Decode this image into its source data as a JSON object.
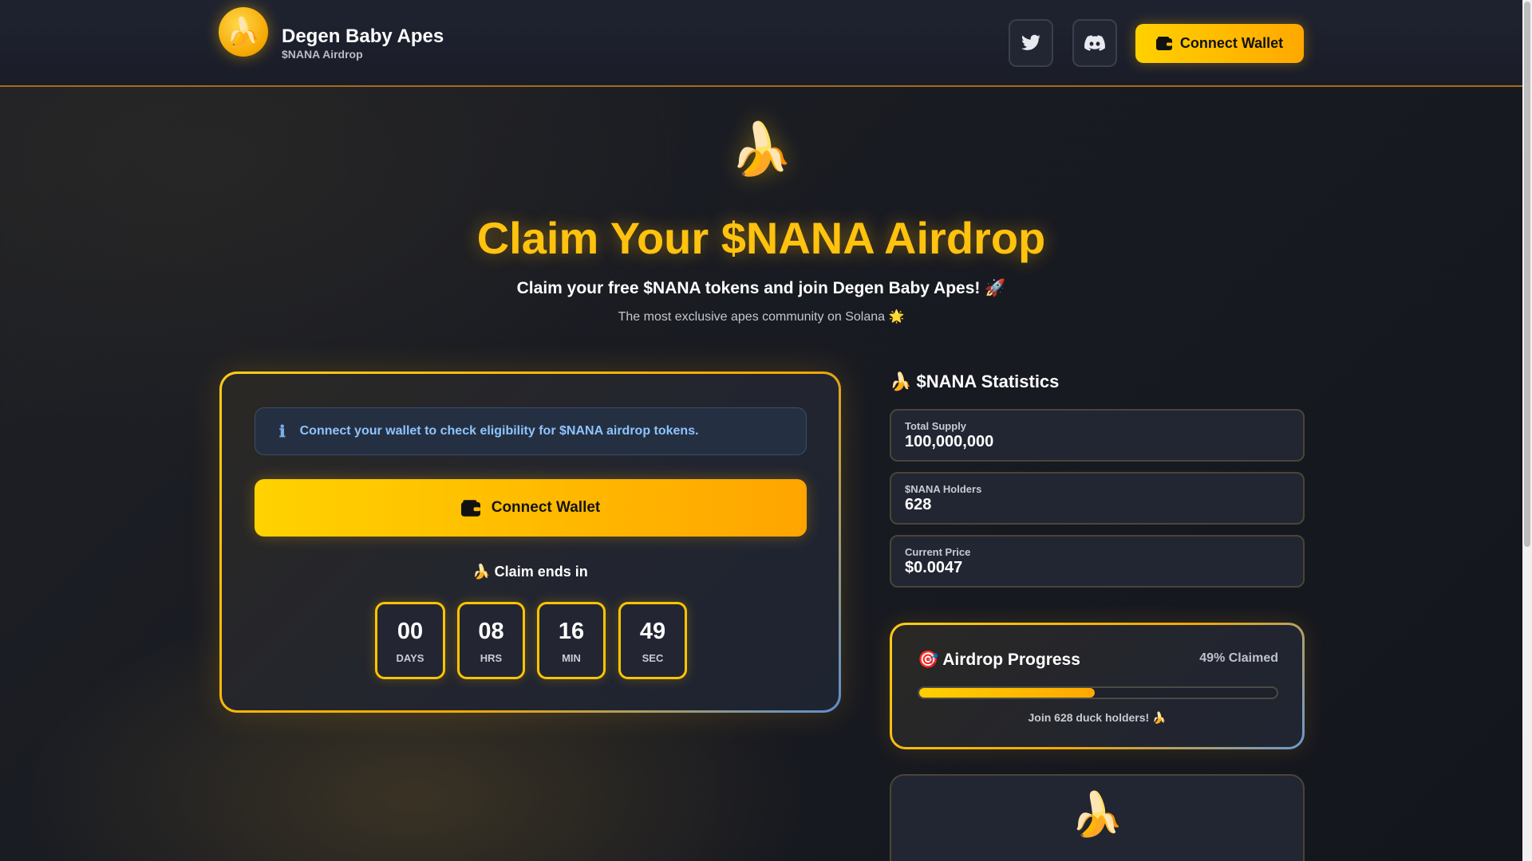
{
  "header": {
    "logo_icon": "🍌",
    "brand_name": "Degen Baby Apes",
    "brand_sub": "$NANA Airdrop",
    "twitter_icon": "twitter-icon",
    "discord_icon": "discord-icon",
    "connect_label": "Connect Wallet"
  },
  "hero": {
    "icon": "🍌",
    "title": "Claim Your $NANA Airdrop",
    "subtitle": "Claim your free $NANA tokens and join Degen Baby Apes! 🚀",
    "tagline": "The most exclusive apes community on Solana 🌟"
  },
  "claim": {
    "info_icon": "ℹ",
    "info_text": "Connect your wallet to check eligibility for $NANA airdrop tokens.",
    "connect_label": "Connect Wallet",
    "ends_label": "🍌 Claim ends in",
    "countdown": [
      {
        "value": "00",
        "label": "DAYS"
      },
      {
        "value": "08",
        "label": "HRS"
      },
      {
        "value": "16",
        "label": "MIN"
      },
      {
        "value": "49",
        "label": "SEC"
      }
    ]
  },
  "stats": {
    "title": "🍌 $NANA Statistics",
    "items": [
      {
        "label": "Total Supply",
        "value": "100,000,000"
      },
      {
        "label": "$NANA Holders",
        "value": "628"
      },
      {
        "label": "Current Price",
        "value": "$0.0047"
      }
    ]
  },
  "progress": {
    "title": "🎯 Airdrop Progress",
    "claimed_label": "49% Claimed",
    "fraction": 0.49,
    "note": "Join 628 duck holders! 🍌"
  },
  "bottom_card": {
    "icon": "🍌"
  },
  "colors": {
    "accent": "#ffc20e",
    "accent_gradient_end": "#ffa500",
    "info_text": "#8fc3ff",
    "background": "#1b1d24"
  }
}
